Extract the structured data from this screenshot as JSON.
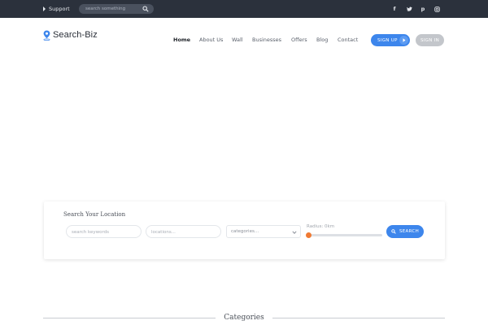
{
  "topbar": {
    "support_label": "Support",
    "search_placeholder": "search something",
    "social": [
      {
        "icon": "facebook-icon",
        "glyph": "f"
      },
      {
        "icon": "twitter-icon",
        "glyph": "t"
      },
      {
        "icon": "pinterest-icon",
        "glyph": "p"
      },
      {
        "icon": "instagram-icon",
        "glyph": "◎"
      }
    ]
  },
  "brand": {
    "name": "Search-Biz",
    "accent": "#3d86ec"
  },
  "nav": {
    "items": [
      {
        "label": "Home",
        "active": true
      },
      {
        "label": "About Us",
        "active": false
      },
      {
        "label": "Wall",
        "active": false
      },
      {
        "label": "Businesses",
        "active": false
      },
      {
        "label": "Offers",
        "active": false
      },
      {
        "label": "Blog",
        "active": false
      },
      {
        "label": "Contact",
        "active": false
      }
    ],
    "signup_label": "SIGN UP",
    "signin_label": "SIGN IN"
  },
  "search_panel": {
    "title": "Search Your Location",
    "keywords_placeholder": "search keywords",
    "locations_placeholder": "locations...",
    "category_value": "categories...",
    "radius_label": "Radius: 0km",
    "radius_value_km": 0,
    "search_label": "SEARCH"
  },
  "categories": {
    "title": "Categories"
  },
  "colors": {
    "topbar": "#2b313c",
    "primary": "#3d86ec",
    "slider_knob": "#f07a33",
    "secondary_button": "#c3c6cb"
  }
}
